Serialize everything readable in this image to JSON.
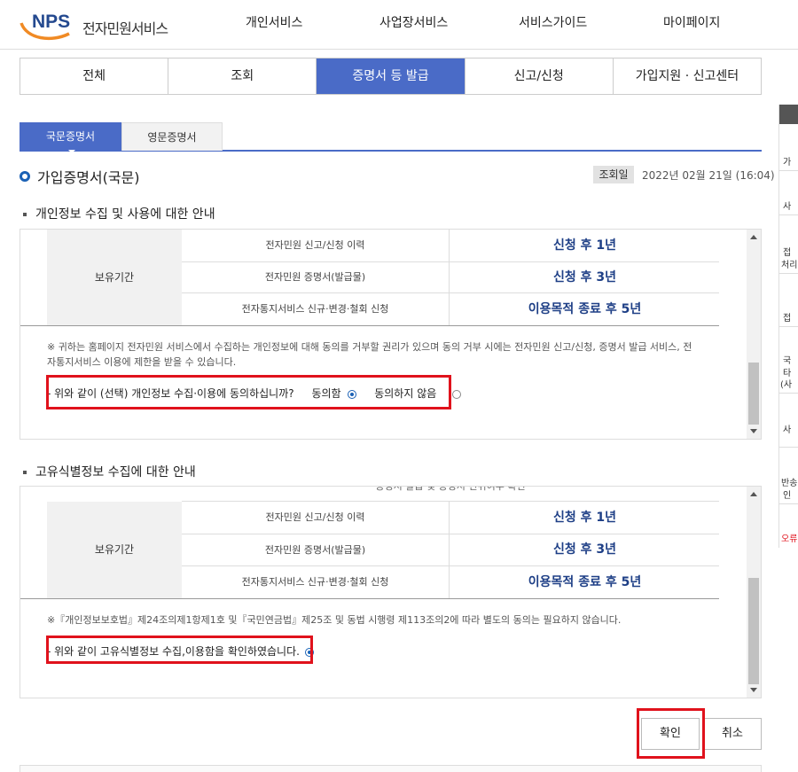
{
  "header": {
    "logo_brand": "NPS",
    "logo_text": "전자민원서비스",
    "gnb": [
      "개인서비스",
      "사업장서비스",
      "서비스가이드",
      "마이페이지"
    ]
  },
  "tabs": [
    "전체",
    "조회",
    "증명서 등 발급",
    "신고/신청",
    "가입지원 · 신고센터"
  ],
  "subtabs": [
    "국문증명서",
    "영문증명서"
  ],
  "page": {
    "title": "가입증명서(국문)",
    "date_label": "조회일",
    "date_value": "2022년 02월 21일 (16:04)"
  },
  "section1": {
    "title": "개인정보 수집 및 사용에 대한 안내",
    "retention_label": "보유기간",
    "rows": [
      {
        "name": "전자민원 신고/신청 이력",
        "period": "신청 후 1년"
      },
      {
        "name": "전자민원 증명서(발급물)",
        "period": "신청 후 3년"
      },
      {
        "name": "전자통지서비스 신규·변경·철회 신청",
        "period": "이용목적 종료 후 5년"
      }
    ],
    "note_line1": "※ 귀하는 홈페이지 전자민원 서비스에서 수집하는 개인정보에 대해 동의를 거부할 권리가 있으며 동의 거부 시에는 전자민원 신고/신청, 증명서 발급 서비스, 전",
    "note_line2": "자통지서비스 이용에 제한을 받을 수 있습니다.",
    "question": "- 위와 같이 (선택) 개인정보 수집·이용에 동의하십니까?",
    "agree": "동의함",
    "disagree": "동의하지 않음"
  },
  "section2": {
    "title": "고유식별정보 수집에 대한 안내",
    "clipped_text": "증명서 발급 및 증명서 진위여부 확인",
    "retention_label": "보유기간",
    "rows": [
      {
        "name": "전자민원 신고/신청 이력",
        "period": "신청 후 1년"
      },
      {
        "name": "전자민원 증명서(발급물)",
        "period": "신청 후 3년"
      },
      {
        "name": "전자통지서비스 신규·변경·철회 신청",
        "period": "이용목적 종료 후 5년"
      }
    ],
    "note": "※『개인정보보호법』제24조의제1항제1호 및『국민연금법』제25조 및 동법 시행령 제113조의2에 따라 별도의 동의는 필요하지 않습니다.",
    "confirm": "- 위와 같이 고유식별정보 수집,이용함을 확인하였습니다."
  },
  "buttons": {
    "ok": "확인",
    "cancel": "취소"
  },
  "side_panel": {
    "items": [
      "가",
      "사",
      "접",
      "처리",
      "접",
      "국",
      "타",
      "(사",
      "사",
      "반송",
      "인",
      "오류"
    ]
  },
  "colors": {
    "accent": "#4a6bc7",
    "highlight": "#e0121c",
    "period_text": "#1e3f86"
  }
}
